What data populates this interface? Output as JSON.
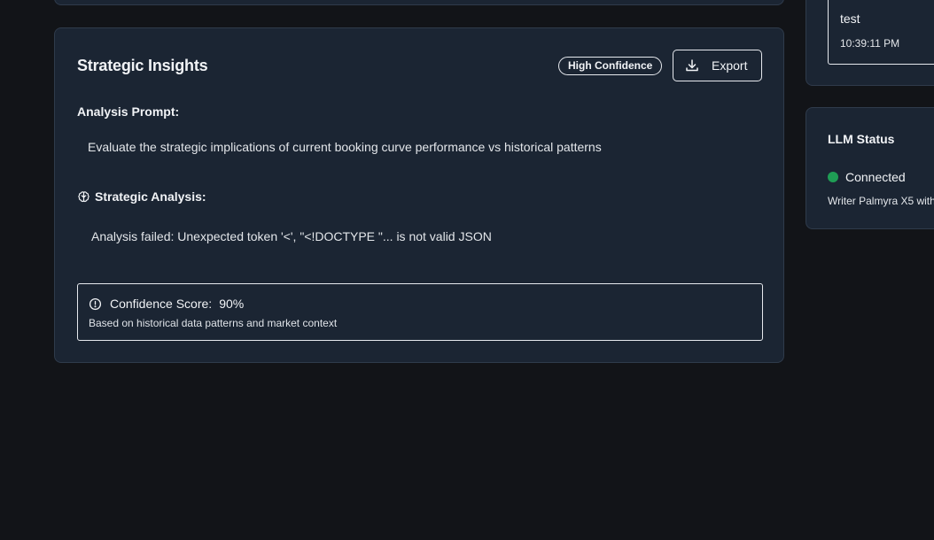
{
  "insights": {
    "title": "Strategic Insights",
    "badge": "High Confidence",
    "export_label": "Export",
    "prompt_label": "Analysis Prompt:",
    "prompt_text": "Evaluate the strategic implications of current booking curve performance vs historical patterns",
    "analysis_label": "Strategic Analysis:",
    "analysis_text": "Analysis failed: Unexpected token '<', \"<!DOCTYPE \"... is not valid JSON",
    "confidence": {
      "label": "Confidence Score:",
      "value": "90%",
      "subtext": "Based on historical data patterns and market context"
    }
  },
  "history_item": {
    "title": "test",
    "time": "10:39:11 PM"
  },
  "llm": {
    "title": "LLM Status",
    "status": "Connected",
    "status_color": "#1f9d55",
    "model": "Writer Palmyra X5 with"
  },
  "icons": {
    "export": "download-icon",
    "analysis": "brain-icon",
    "confidence": "alert-circle-icon"
  }
}
